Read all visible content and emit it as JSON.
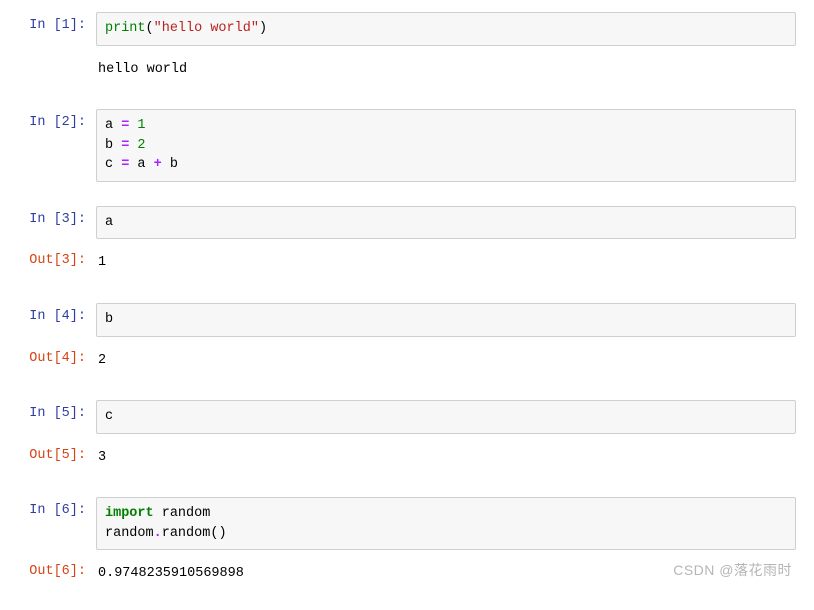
{
  "cells": {
    "c1": {
      "prompt_in": "In [1]:",
      "tok_print": "print",
      "tok_lp": "(",
      "tok_str": "\"hello world\"",
      "tok_rp": ")",
      "output": "hello world"
    },
    "c2": {
      "prompt_in": "In [2]:",
      "line1_a": "a ",
      "line1_eq": "=",
      "line1_v": " 1",
      "line2_a": "b ",
      "line2_eq": "=",
      "line2_v": " 2",
      "line3_a": "c ",
      "line3_eq": "=",
      "line3_v1": " a ",
      "line3_plus": "+",
      "line3_v2": " b"
    },
    "c3": {
      "prompt_in": "In [3]:",
      "code": "a",
      "prompt_out": "Out[3]:",
      "output": "1"
    },
    "c4": {
      "prompt_in": "In [4]:",
      "code": "b",
      "prompt_out": "Out[4]:",
      "output": "2"
    },
    "c5": {
      "prompt_in": "In [5]:",
      "code": "c",
      "prompt_out": "Out[5]:",
      "output": "3"
    },
    "c6": {
      "prompt_in": "In [6]:",
      "tok_import": "import",
      "tok_sp": " ",
      "tok_random1": "random",
      "tok_nl_random2": "random",
      "tok_dot": ".",
      "tok_randomfn": "random",
      "tok_lp": "(",
      "tok_rp": ")",
      "prompt_out": "Out[6]:",
      "output": "0.9748235910569898"
    }
  },
  "watermark": "CSDN @落花雨时"
}
